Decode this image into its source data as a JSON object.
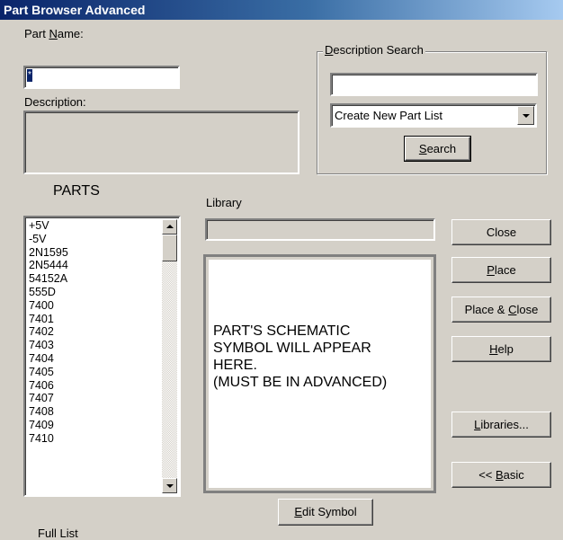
{
  "window": {
    "title": "Part Browser Advanced"
  },
  "part_name": {
    "label_pre": "Part ",
    "label_key": "N",
    "label_post": "ame:",
    "value": "*"
  },
  "description": {
    "label": "Description:"
  },
  "description_search": {
    "label_key": "D",
    "label_post": "escription Search",
    "input_value": "",
    "dropdown_selected": "Create New Part List",
    "search_pre": "",
    "search_key": "S",
    "search_post": "earch"
  },
  "parts": {
    "heading": "PARTS",
    "items": [
      "+5V",
      "-5V",
      "2N1595",
      "2N5444",
      "54152A",
      "555D",
      "7400",
      "7401",
      "7402",
      "7403",
      "7404",
      "7405",
      "7406",
      "7407",
      "7408",
      "7409",
      "7410"
    ],
    "footer": "Full List"
  },
  "library": {
    "label": "Library",
    "value": ""
  },
  "preview": {
    "line1": "PART'S SCHEMATIC",
    "line2": "SYMBOL WILL APPEAR",
    "line3": "HERE.",
    "line4": "(MUST BE IN ADVANCED)"
  },
  "buttons": {
    "close": "Close",
    "place_key": "P",
    "place_post": "lace",
    "place_close_pre": "Place & ",
    "place_close_key": "C",
    "place_close_post": "lose",
    "help_key": "H",
    "help_post": "elp",
    "libraries_key": "L",
    "libraries_post": "ibraries...",
    "basic_pre": "<< ",
    "basic_key": "B",
    "basic_post": "asic",
    "edit_key": "E",
    "edit_post": "dit Symbol"
  },
  "icons": {
    "scroll_up": "scroll-up-icon",
    "scroll_down": "scroll-down-icon",
    "dropdown": "chevron-down-icon"
  }
}
